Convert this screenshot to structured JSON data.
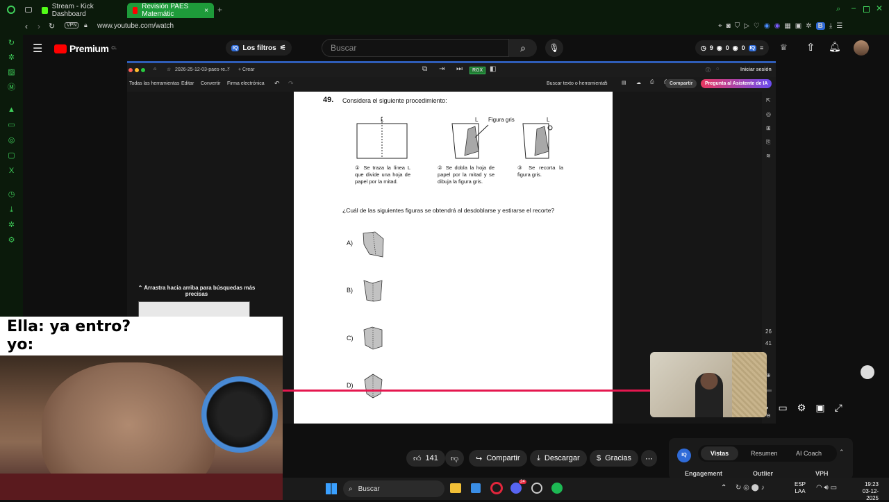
{
  "browser": {
    "tabs": [
      {
        "label": "Stream - Kick Dashboard"
      },
      {
        "label": "Revisión PAES Matemátic"
      }
    ],
    "vpn_label": "VPN",
    "url": "www.youtube.com/watch",
    "profile_initial": "B"
  },
  "youtube": {
    "logo_text": "Premium",
    "region": "CL",
    "filters_label": "Los filtros",
    "iq_badge": "IQ",
    "search_placeholder": "Buscar",
    "stats": [
      "9",
      "0",
      "0"
    ]
  },
  "pdf": {
    "tab_title": "2026-25-12-03-paes-re...",
    "create_label": "+ Crear",
    "rgx_label": "RGX",
    "login_label": "Iniciar sesión",
    "tools": [
      "Todas las herramientas",
      "Editar",
      "Convertir",
      "Firma electrónica"
    ],
    "search_tools": "Buscar texto o herramientas",
    "share": "Compartir",
    "ai_assist": "Pregunta al Asistente de IA",
    "page_numbers": [
      "26",
      "41"
    ]
  },
  "question": {
    "number": "49.",
    "prompt": "Considera el siguiente procedimiento:",
    "line_label": "L",
    "figure_label": "Figura gris",
    "steps": [
      "① Se traza la línea L que divide una hoja de papel por la mitad.",
      "② Se dobla la hoja de papel por la mitad y se dibuja la figura gris.",
      "③ Se recorta la figura gris."
    ],
    "question_text": "¿Cuál de las siguientes figuras se obtendrá al desdoblarse y estirarse el recorte?",
    "options": [
      "A)",
      "B)",
      "C)",
      "D)"
    ]
  },
  "side_panel": {
    "hint": "⌃ Arrastra hacia arriba para búsquedas más precisas"
  },
  "meme": {
    "line1": "Ella: ya entro?",
    "line2": "yo:"
  },
  "actions": {
    "likes": "141",
    "share": "Compartir",
    "download": "Descargar",
    "thanks": "Gracias"
  },
  "stats_panel": {
    "iq": "IQ",
    "tabs": [
      "Vistas",
      "Resumen",
      "AI Coach"
    ],
    "cols": [
      "Engagement",
      "Outlier",
      "VPH"
    ]
  },
  "taskbar": {
    "search": "Buscar",
    "lang": "ESP",
    "lang2": "LAA",
    "time": "19:23",
    "date": "03-12-2025",
    "badge_count": "24"
  },
  "colors": {
    "accent_green": "#1e9b3a",
    "progress_red": "#e5174f",
    "ai_button": "#e8385f"
  },
  "progress": 0.78
}
